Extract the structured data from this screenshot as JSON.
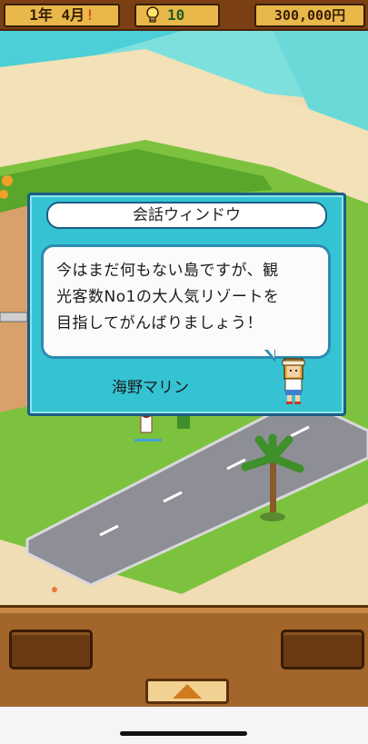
{
  "status_bar": {
    "date": "1年 4月",
    "date_alert": "!",
    "idea_points": "10",
    "money": "300,000円"
  },
  "dialog": {
    "title": "会話ウィンドウ",
    "lines": [
      "今はまだ何もない島ですが、観",
      "光客数No1の大人気リゾートを",
      "目指してがんばりましょう！"
    ],
    "speaker": "海野マリン"
  },
  "icons": {
    "idea": "lightbulb-icon",
    "menu_toggle": "up-arrow-icon"
  },
  "colors": {
    "dialog_bg": "#35c3d3",
    "wood": "#a2652a",
    "sea": "#5fd6d6",
    "sand": "#f0ddb4",
    "grass": "#7cc23e",
    "road": "#8e8f96"
  }
}
